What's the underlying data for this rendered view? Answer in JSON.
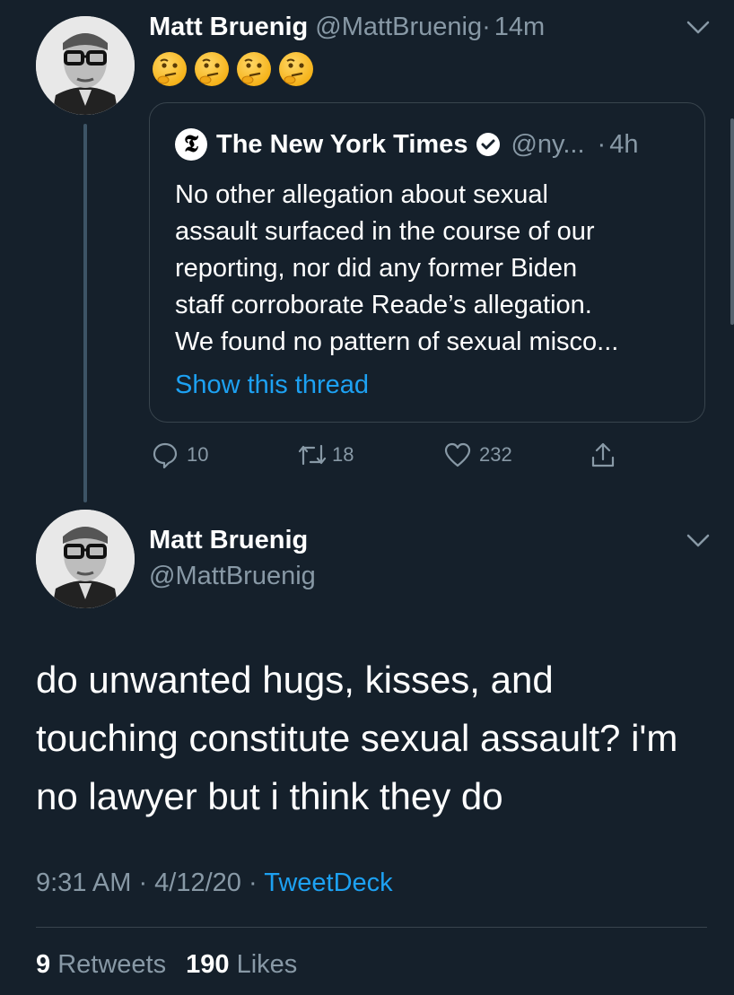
{
  "reply_tweet": {
    "author_name": "Matt Bruenig",
    "author_handle": "@MattBruenig",
    "separator": "·",
    "time": "14m",
    "emoji_count": 4,
    "emoji_icon": "thinking-face-icon",
    "quoted": {
      "author_name": "The New York Times",
      "author_handle": "@ny...",
      "time_prefix": "·",
      "time": "4h",
      "logo_glyph": "𝕿",
      "text_lines": [
        "No other allegation about sexual",
        "assault surfaced in the course of our",
        "reporting, nor did any former Biden",
        "staff corroborate Reade’s allegation.",
        "We found no pattern of sexual misco..."
      ],
      "show_thread": "Show this thread"
    },
    "actions": {
      "replies": "10",
      "retweets": "18",
      "likes": "232"
    }
  },
  "main_tweet": {
    "author_name": "Matt Bruenig",
    "author_handle": "@MattBruenig",
    "text_lines": [
      "do unwanted hugs, kisses, and",
      "touching constitute sexual assault? i'm",
      "no lawyer but i think they do"
    ],
    "timestamp": "9:31 AM · 4/12/20 ·",
    "source": "TweetDeck",
    "retweet_count": "9",
    "retweet_label": "Retweets",
    "like_count": "190",
    "like_label": "Likes"
  },
  "colors": {
    "background": "#15202b",
    "muted": "#8899a6",
    "link": "#1da1f2",
    "border": "#38444d"
  }
}
